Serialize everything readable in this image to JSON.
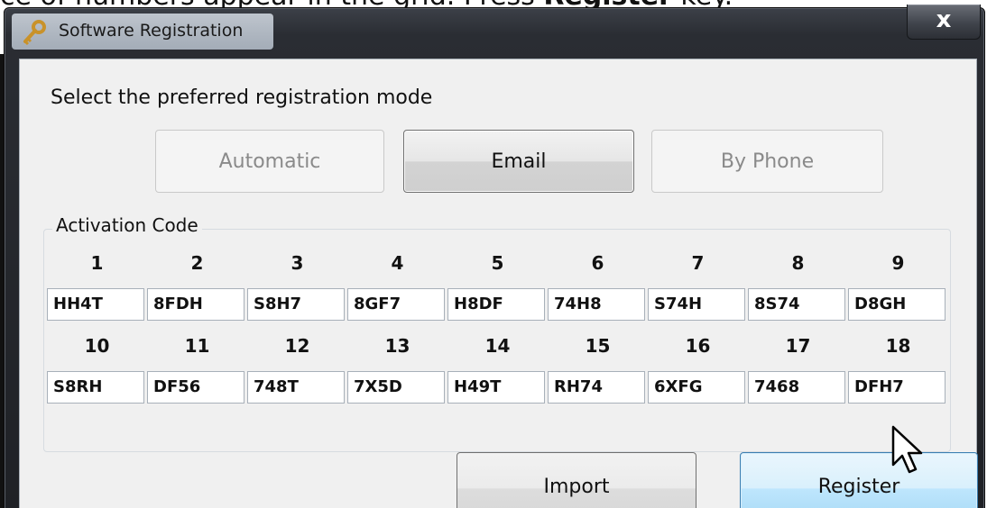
{
  "top_text": {
    "prefix": "ce of numbers appear in the grid. Press ",
    "bold": "Register",
    "suffix": " key."
  },
  "window": {
    "title": "Software Registration",
    "close_label": "x"
  },
  "prompt": "Select the preferred registration mode",
  "modes": {
    "automatic": "Automatic",
    "email": "Email",
    "phone": "By Phone"
  },
  "activation": {
    "label": "Activation Code",
    "row1": {
      "numbers": [
        "1",
        "2",
        "3",
        "4",
        "5",
        "6",
        "7",
        "8",
        "9"
      ],
      "codes": [
        "HH4T",
        "8FDH",
        "S8H7",
        "8GF7",
        "H8DF",
        "74H8",
        "S74H",
        "8S74",
        "D8GH"
      ]
    },
    "row2": {
      "numbers": [
        "10",
        "11",
        "12",
        "13",
        "14",
        "15",
        "16",
        "17",
        "18"
      ],
      "codes": [
        "S8RH",
        "DF56",
        "748T",
        "7X5D",
        "H49T",
        "RH74",
        "6XFG",
        "7468",
        "DFH7"
      ]
    }
  },
  "actions": {
    "import": "Import",
    "register": "Register"
  },
  "icons": {
    "title": "key-icon",
    "cursor": "mouse-pointer-icon"
  },
  "colors": {
    "register_accent": "#3c7fb1",
    "client_bg": "#f0f0f0"
  }
}
